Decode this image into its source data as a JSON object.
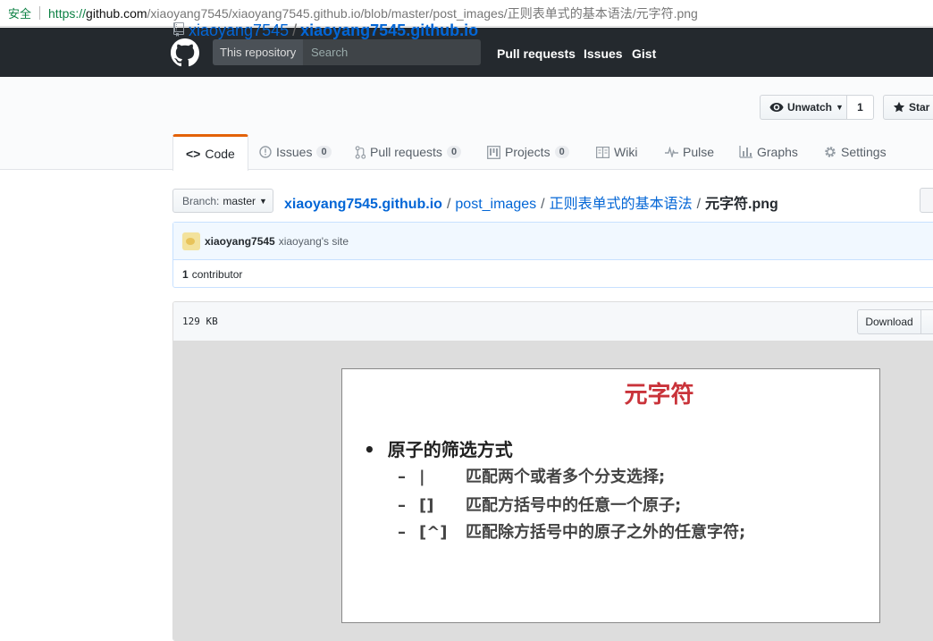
{
  "browser": {
    "secure_label": "安全",
    "url_scheme": "https://",
    "url_domain": "github.com",
    "url_path": "/xiaoyang7545/xiaoyang7545.github.io/blob/master/post_images/正则表单式的基本语法/元字符.png"
  },
  "header": {
    "scope_label": "This repository",
    "search_placeholder": "Search",
    "nav": [
      "Pull requests",
      "Issues",
      "Gist"
    ]
  },
  "repo": {
    "owner": "xiaoyang7545",
    "separator": "/",
    "name": "xiaoyang7545.github.io",
    "watch_label": "Unwatch",
    "watch_count": "1",
    "star_label": "Star"
  },
  "tabs": [
    {
      "label": "Code",
      "counter": null
    },
    {
      "label": "Issues",
      "counter": "0"
    },
    {
      "label": "Pull requests",
      "counter": "0"
    },
    {
      "label": "Projects",
      "counter": "0"
    },
    {
      "label": "Wiki",
      "counter": null
    },
    {
      "label": "Pulse",
      "counter": null
    },
    {
      "label": "Graphs",
      "counter": null
    },
    {
      "label": "Settings",
      "counter": null
    }
  ],
  "file_nav": {
    "branch_label": "Branch:",
    "branch_name": "master",
    "crumbs": [
      "xiaoyang7545.github.io",
      "post_images",
      "正则表单式的基本语法"
    ],
    "separator": "/",
    "file_name": "元字符.png"
  },
  "commit": {
    "author": "xiaoyang7545",
    "message": "xiaoyang's site",
    "contributor_count": "1",
    "contributor_label": "contributor"
  },
  "file": {
    "size": "129 KB",
    "download_label": "Download"
  },
  "slide": {
    "title": "元字符",
    "bullet_dot": "•",
    "bullet": "原子的筛选方式",
    "sub_dash": "–",
    "items": [
      {
        "symbol": "|",
        "text": "匹配两个或者多个分支选择;"
      },
      {
        "symbol": "[]",
        "text": "匹配方括号中的任意一个原子;"
      },
      {
        "symbol": "[^]",
        "text": "匹配除方括号中的原子之外的任意字符;"
      }
    ]
  }
}
